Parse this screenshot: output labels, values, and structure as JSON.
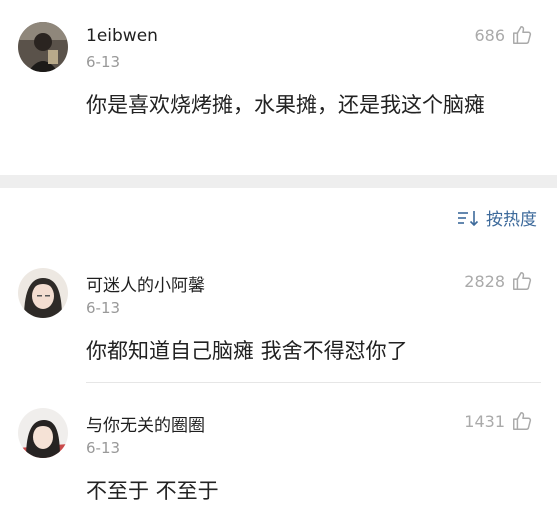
{
  "comments_top": [
    {
      "username": "1eibwen",
      "date": "6-13",
      "likes": "686",
      "text": "你是喜欢烧烤摊，水果摊，还是我这个脑瘫"
    }
  ],
  "sort": {
    "label": "按热度"
  },
  "comments": [
    {
      "username": "可迷人的小阿馨",
      "date": "6-13",
      "likes": "2828",
      "text": "你都知道自己脑瘫 我舍不得怼你了"
    },
    {
      "username": "与你无关的圈圈",
      "date": "6-13",
      "likes": "1431",
      "text": "不至于 不至于"
    }
  ],
  "colors": {
    "accent_blue": "#3d6a9b",
    "meta_gray": "#999999",
    "separator": "#eeeeee"
  }
}
